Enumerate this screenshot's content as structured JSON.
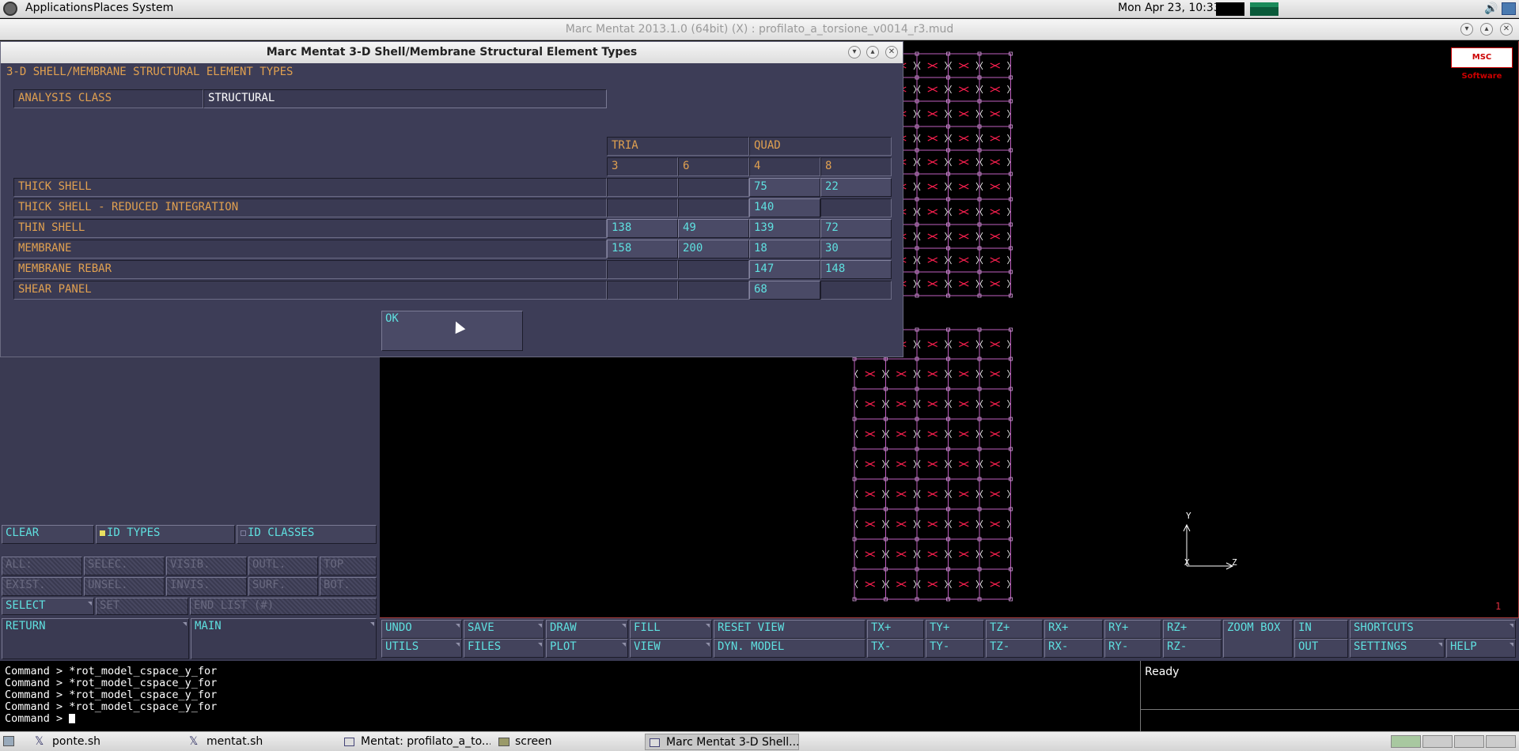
{
  "topbar": {
    "menus": [
      "Applications",
      "Places",
      "System"
    ],
    "clock": "Mon Apr 23, 10:33"
  },
  "window": {
    "title": "Marc Mentat 2013.1.0 (64bit) (X) : profilato_a_torsione_v0014_r3.mud"
  },
  "dialog": {
    "title": "Marc Mentat 3-D Shell/Membrane Structural Element Types",
    "heading": "3-D SHELL/MEMBRANE STRUCTURAL ELEMENT TYPES",
    "analysis_class_label": "ANALYSIS CLASS",
    "analysis_class_value": "STRUCTURAL",
    "col_groups": [
      "TRIA",
      "QUAD"
    ],
    "col_nodes": [
      "3",
      "6",
      "4",
      "8"
    ],
    "rows": [
      {
        "label": "THICK SHELL",
        "values": [
          "",
          "",
          "75",
          "22"
        ]
      },
      {
        "label": "THICK SHELL - REDUCED INTEGRATION",
        "values": [
          "",
          "",
          "140",
          ""
        ]
      },
      {
        "label": "THIN SHELL",
        "values": [
          "138",
          "49",
          "139",
          "72"
        ]
      },
      {
        "label": "MEMBRANE",
        "values": [
          "158",
          "200",
          "18",
          "30"
        ]
      },
      {
        "label": "MEMBRANE REBAR",
        "values": [
          "",
          "",
          "147",
          "148"
        ]
      },
      {
        "label": "SHEAR PANEL",
        "values": [
          "",
          "",
          "68",
          ""
        ]
      }
    ],
    "ok_label": "OK"
  },
  "left_panel": {
    "clear": "CLEAR",
    "id_types": "ID TYPES",
    "id_classes": "ID CLASSES",
    "row1": [
      "ALL:",
      "SELEC.",
      "VISIB.",
      "OUTL.",
      "TOP"
    ],
    "row2": [
      "EXIST.",
      "UNSEL.",
      "INVIS.",
      "SURF.",
      "BOT."
    ],
    "select": "SELECT",
    "set": "SET",
    "end_list": "END LIST (#)",
    "return": "RETURN",
    "main": "MAIN"
  },
  "toolbar": {
    "row1": [
      "UNDO",
      "SAVE",
      "DRAW",
      "FILL",
      "RESET VIEW",
      "TX+",
      "TY+",
      "TZ+",
      "RX+",
      "RY+",
      "RZ+"
    ],
    "row2": [
      "UTILS",
      "FILES",
      "PLOT",
      "VIEW",
      "DYN. MODEL",
      "TX-",
      "TY-",
      "TZ-",
      "RX-",
      "RY-",
      "RZ-"
    ],
    "zoom_box": "ZOOM BOX",
    "in": "IN",
    "out": "OUT",
    "shortcuts": "SHORTCUTS",
    "settings": "SETTINGS",
    "help": "HELP"
  },
  "viewport": {
    "logo_text": "MSC Software",
    "axis_y": "Y",
    "axis_z": "Z",
    "axis_x": "X",
    "page_number": "1",
    "colors": {
      "mesh": "#c060c0",
      "element": "#ff2050",
      "border": "#d04040"
    }
  },
  "command": {
    "lines": [
      "Command > *rot_model_cspace_y_for",
      "Command > *rot_model_cspace_y_for",
      "Command > *rot_model_cspace_y_for",
      "Command > *rot_model_cspace_y_for",
      "Command > "
    ]
  },
  "status": {
    "text": "Ready"
  },
  "taskbar": {
    "tasks": [
      "ponte.sh",
      "mentat.sh",
      "Mentat: profilato_a_to...",
      "screen",
      "Marc Mentat 3-D Shell..."
    ]
  }
}
